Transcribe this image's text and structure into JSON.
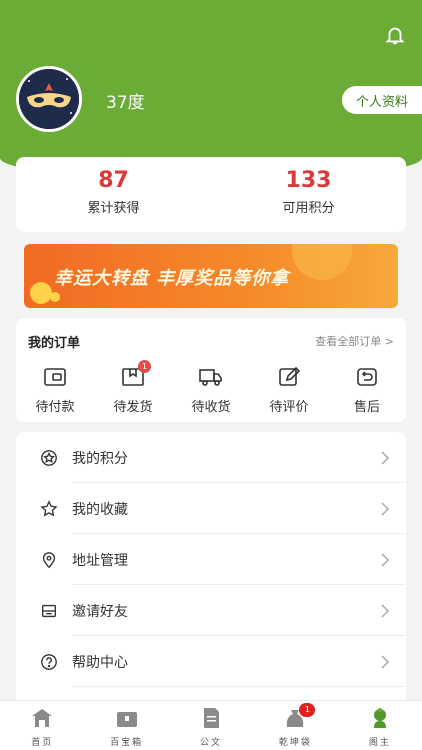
{
  "header": {
    "username": "37度",
    "profile_button": "个人资料"
  },
  "stats": [
    {
      "value": "87",
      "label": "累计获得"
    },
    {
      "value": "133",
      "label": "可用积分"
    }
  ],
  "banner": {
    "text": "幸运大转盘  丰厚奖品等你拿"
  },
  "orders": {
    "title": "我的订单",
    "view_all": "查看全部订单 >",
    "items": [
      {
        "label": "待付款",
        "icon": "wallet-icon"
      },
      {
        "label": "待发货",
        "icon": "package-icon",
        "badge": "1"
      },
      {
        "label": "待收货",
        "icon": "truck-icon"
      },
      {
        "label": "待评价",
        "icon": "edit-icon"
      },
      {
        "label": "售后",
        "icon": "return-icon"
      }
    ]
  },
  "menu": [
    {
      "label": "我的积分",
      "icon": "points-icon"
    },
    {
      "label": "我的收藏",
      "icon": "star-icon"
    },
    {
      "label": "地址管理",
      "icon": "location-icon"
    },
    {
      "label": "邀请好友",
      "icon": "invite-icon"
    },
    {
      "label": "帮助中心",
      "icon": "help-icon"
    }
  ],
  "tabbar": [
    {
      "label": "首页",
      "icon": "home-icon"
    },
    {
      "label": "百宝箱",
      "icon": "treasure-box-icon"
    },
    {
      "label": "公文",
      "icon": "document-icon"
    },
    {
      "label": "乾坤袋",
      "icon": "bag-icon",
      "badge": "1"
    },
    {
      "label": "阁主",
      "icon": "owner-icon"
    }
  ],
  "colors": {
    "brand_green": "#6aac35",
    "accent_red": "#d93a3a",
    "banner_orange": "#f26a24"
  }
}
